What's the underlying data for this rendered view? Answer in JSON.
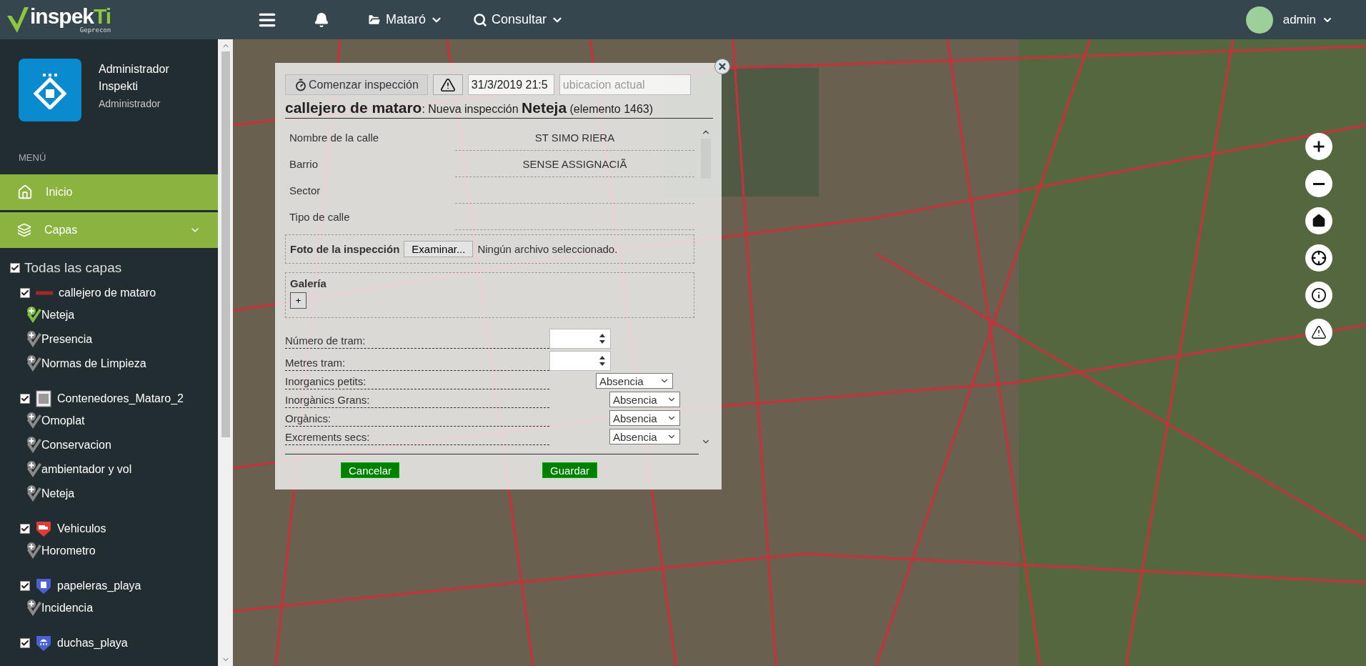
{
  "header": {
    "logo_main": "inspek",
    "logo_accent": "Ti",
    "logo_sub": "Geprecon",
    "nav": [
      {
        "kind": "folder",
        "label": "Mataró"
      },
      {
        "kind": "search",
        "label": "Consultar"
      }
    ],
    "user": "admin"
  },
  "sidebar": {
    "profile": {
      "name_line_1": "Administrador",
      "name_line_2": "Inspekti",
      "role": "Administrador"
    },
    "menu_heading": "MENÚ",
    "menu": [
      {
        "kind": "home",
        "label": "Inicio"
      },
      {
        "kind": "layers",
        "label": "Capas",
        "expanded": true
      }
    ],
    "all_layers": {
      "label": "Todas las capas",
      "checked": true
    },
    "layers": [
      {
        "kind": "line",
        "name": "callejero de mataro",
        "checked": true,
        "children": [
          {
            "label": "Neteja",
            "selected": true
          },
          {
            "label": "Presencia",
            "selected": false
          },
          {
            "label": "Normas de Limpieza",
            "selected": false
          }
        ]
      },
      {
        "kind": "container",
        "name": "Contenedores_Mataro_2",
        "checked": true,
        "children": [
          {
            "label": "Omoplat",
            "selected": false
          },
          {
            "label": "Conservacion",
            "selected": false
          },
          {
            "label": "ambientador y vol",
            "selected": false
          },
          {
            "label": "Neteja",
            "selected": false
          }
        ]
      },
      {
        "kind": "vehicle",
        "name": "Vehiculos",
        "checked": true,
        "children": [
          {
            "label": "Horometro",
            "selected": false
          }
        ]
      },
      {
        "kind": "bin",
        "name": "papeleras_playa",
        "checked": true,
        "children": [
          {
            "label": "Incidencia",
            "selected": false
          }
        ]
      },
      {
        "kind": "shower",
        "name": "duchas_playa",
        "checked": true
      }
    ]
  },
  "dialog": {
    "toolbar": {
      "start": "Comenzar inspección",
      "date": "31/3/2019 21:5",
      "location_placeholder": "ubicacion actual"
    },
    "title": "**callejero de mataro**: Nueva inspección **Neteja** (elemento 1463)",
    "info_rows": [
      {
        "label": "Nombre de la calle",
        "value": "ST SIMO RIERA"
      },
      {
        "label": "Barrio",
        "value": "SENSE ASSIGNACIÃ"
      },
      {
        "label": "Sector"
      },
      {
        "label": "Tipo de calle"
      }
    ],
    "photo": {
      "label": "Foto de la inspección",
      "button": "Examinar...",
      "status": "Ningún archivo seleccionado."
    },
    "gallery": {
      "label": "Galería",
      "add": "+"
    },
    "fields": [
      {
        "kind": "number",
        "label": "Número de tram:"
      },
      {
        "kind": "number",
        "label": "Metres tram:"
      },
      {
        "kind": "select",
        "label": "Inorganics petits:",
        "value": "Absencia"
      },
      {
        "kind": "select",
        "label": "Inorgànics Grans:",
        "value": "Absencia"
      },
      {
        "kind": "select",
        "label": "Orgànics:",
        "value": "Absencia"
      },
      {
        "kind": "select",
        "label": "Excrements secs:",
        "value": "Absencia"
      }
    ],
    "actions": {
      "cancel": "Cancelar",
      "save": "Guardar"
    }
  }
}
